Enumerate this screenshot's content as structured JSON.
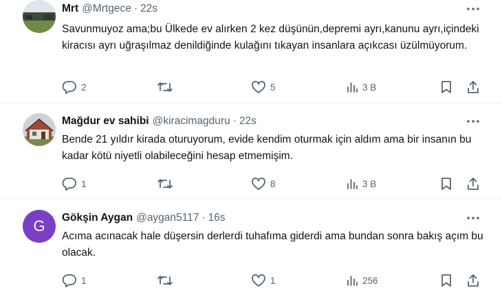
{
  "tweets": [
    {
      "name": "Mrt",
      "handle": "@Mrtgece",
      "dot": "·",
      "time": "22s",
      "text": "Savunmuyoz ama;bu Ülkede ev alırken 2 kez düşünün,depremi ayrı,kanunu ayrı,içindeki kiracısı ayrı uğraşılmaz denildiğinde kulağını tıkayan insanlara açıkcası üzülmüyorum.",
      "replies": "2",
      "retweets": "",
      "likes": "5",
      "views": "3 B"
    },
    {
      "name": "Mağdur ev sahibi",
      "handle": "@kiracimagduru",
      "dot": "·",
      "time": "22s",
      "text": "Bende 21 yıldır kirada oturuyorum, evide kendim oturmak için aldım ama bir insanın bu kadar kötü niyetli olabileceğini hesap etmemişim.",
      "replies": "1",
      "retweets": "",
      "likes": "8",
      "views": "3 B"
    },
    {
      "name": "Gökşin Aygan",
      "handle": "@aygan5117",
      "dot": "·",
      "time": "16s",
      "avatar_letter": "G",
      "text": "Acıma acınacak hale düşersin derlerdi tuhafıma giderdi ama bundan sonra bakış açım bu olacak.",
      "replies": "1",
      "retweets": "",
      "likes": "1",
      "views": "256"
    }
  ],
  "icons": {
    "more": "more-horizontal-icon",
    "reply": "reply-icon",
    "retweet": "retweet-icon",
    "like": "heart-icon",
    "views": "views-chart-icon",
    "bookmark": "bookmark-icon",
    "share": "share-icon"
  },
  "colors": {
    "text": "#0f1419",
    "secondary": "#536471",
    "divider": "#eff3f4",
    "avatar_g": "#7b3fc6"
  }
}
